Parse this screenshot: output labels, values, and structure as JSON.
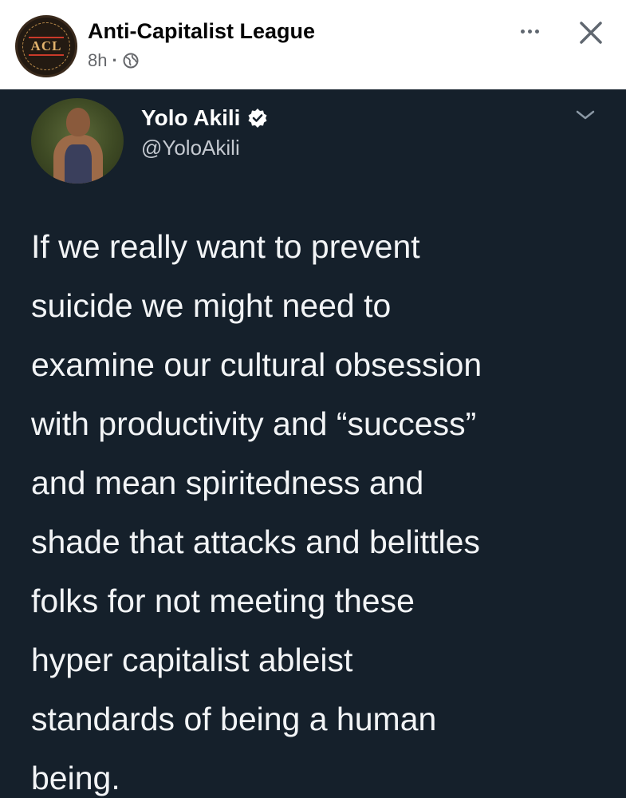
{
  "post": {
    "page_name": "Anti-Capitalist League",
    "timestamp": "8h",
    "separator": "·",
    "audience_icon": "globe-icon",
    "logo_text": "ACL"
  },
  "tweet": {
    "author_name": "Yolo Akili",
    "handle": "@YoloAkili",
    "verified_icon": "verified-badge-icon",
    "lines": [
      "If we really want to prevent",
      "suicide we might need to",
      "examine our cultural obsession",
      "with productivity and “success”",
      "and mean spiritedness and",
      "shade that attacks and belittles",
      "folks for not meeting these",
      "hyper capitalist ableist",
      "standards of being a human",
      "being."
    ]
  },
  "colors": {
    "tweet_background": "#15202b",
    "tweet_text": "#f2f4f6",
    "handle_text": "#c4c9d0",
    "meta_text": "#65676b"
  }
}
